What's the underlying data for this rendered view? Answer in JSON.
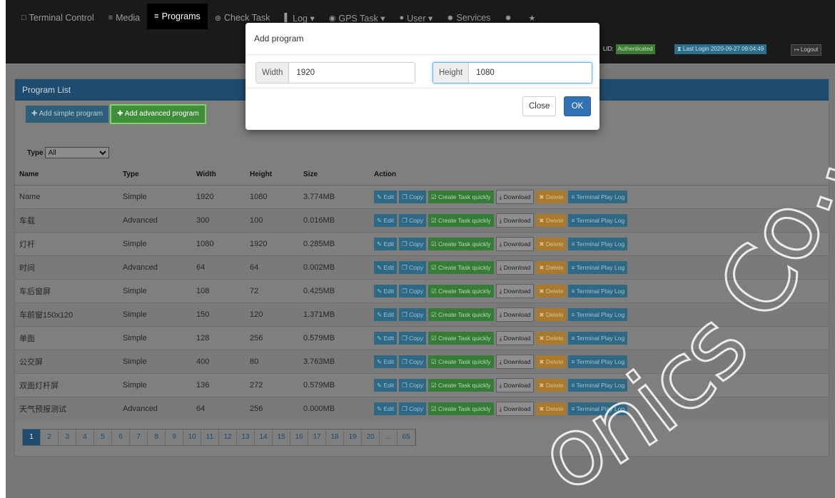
{
  "nav": [
    {
      "icon": "□",
      "icon_name": "tablet-icon",
      "label": "Terminal Control",
      "name": "nav-terminal-control"
    },
    {
      "icon": "≡",
      "icon_name": "media-icon",
      "label": "Media",
      "name": "nav-media"
    },
    {
      "icon": "≡",
      "icon_name": "programs-icon",
      "label": "Programs",
      "name": "nav-programs",
      "active": true
    },
    {
      "icon": "⊛",
      "icon_name": "check-circle-icon",
      "label": "Check Task",
      "name": "nav-check-task"
    },
    {
      "icon": "▌",
      "icon_name": "chart-icon",
      "label": "Log ▾",
      "name": "nav-log"
    },
    {
      "icon": "◉",
      "icon_name": "globe-icon",
      "label": "GPS Task ▾",
      "name": "nav-gps-task"
    },
    {
      "icon": "●",
      "icon_name": "user-icon",
      "label": "User ▾",
      "name": "nav-user"
    },
    {
      "icon": "✹",
      "icon_name": "gear-icon",
      "label": "Services",
      "name": "nav-services"
    },
    {
      "icon": "✹",
      "icon_name": "settings-icon",
      "label": "",
      "name": "nav-settings"
    },
    {
      "icon": "★",
      "icon_name": "star-icon",
      "label": "",
      "name": "nav-favorites"
    }
  ],
  "status": {
    "license_prefix": "LID:",
    "license_badge": "Authenticated",
    "last_login": "⧗ Last Login 2020-09-27 09:04:49",
    "logout": "↦ Logout"
  },
  "panel": {
    "title": "Program List",
    "add_simple": "✚ Add simple program",
    "add_advanced": "✚ Add advanced program",
    "type_label": "Type",
    "type_selected": "All"
  },
  "table": {
    "headers": [
      "Name",
      "Type",
      "Width",
      "Height",
      "Size",
      "Action"
    ],
    "rows": [
      {
        "name": "Name",
        "type": "Simple",
        "width": "1920",
        "height": "1080",
        "size": "3.774MB"
      },
      {
        "name": "车载",
        "type": "Advanced",
        "width": "300",
        "height": "100",
        "size": "0.016MB"
      },
      {
        "name": "灯杆",
        "type": "Simple",
        "width": "1080",
        "height": "1920",
        "size": "0.285MB"
      },
      {
        "name": "时间",
        "type": "Advanced",
        "width": "64",
        "height": "64",
        "size": "0.002MB"
      },
      {
        "name": "车后窗屏",
        "type": "Simple",
        "width": "108",
        "height": "72",
        "size": "0.425MB"
      },
      {
        "name": "车前窗150x120",
        "type": "Simple",
        "width": "150",
        "height": "120",
        "size": "1.371MB"
      },
      {
        "name": "单面",
        "type": "Simple",
        "width": "128",
        "height": "256",
        "size": "0.579MB"
      },
      {
        "name": "公交屏",
        "type": "Simple",
        "width": "400",
        "height": "80",
        "size": "3.763MB"
      },
      {
        "name": "双面灯杆屏",
        "type": "Simple",
        "width": "136",
        "height": "272",
        "size": "0.579MB"
      },
      {
        "name": "天气预报测试",
        "type": "Advanced",
        "width": "64",
        "height": "256",
        "size": "0.000MB"
      }
    ],
    "actions": {
      "edit": "✎ Edit",
      "copy": "❐ Copy",
      "task": "☑ Create Task quickly",
      "download": "⤓ Download",
      "delete": "✖ Delete",
      "log": "≡ Terminal Play Log"
    }
  },
  "pager": [
    "1",
    "2",
    "3",
    "4",
    "5",
    "6",
    "7",
    "8",
    "9",
    "10",
    "11",
    "12",
    "13",
    "14",
    "15",
    "16",
    "17",
    "18",
    "19",
    "20",
    "…",
    "65"
  ],
  "modal": {
    "title": "Add program",
    "width_label": "Width",
    "width_value": "1920",
    "height_label": "Height",
    "height_value": "1080",
    "close": "Close",
    "ok": "OK"
  },
  "watermark": "onics Co., L"
}
